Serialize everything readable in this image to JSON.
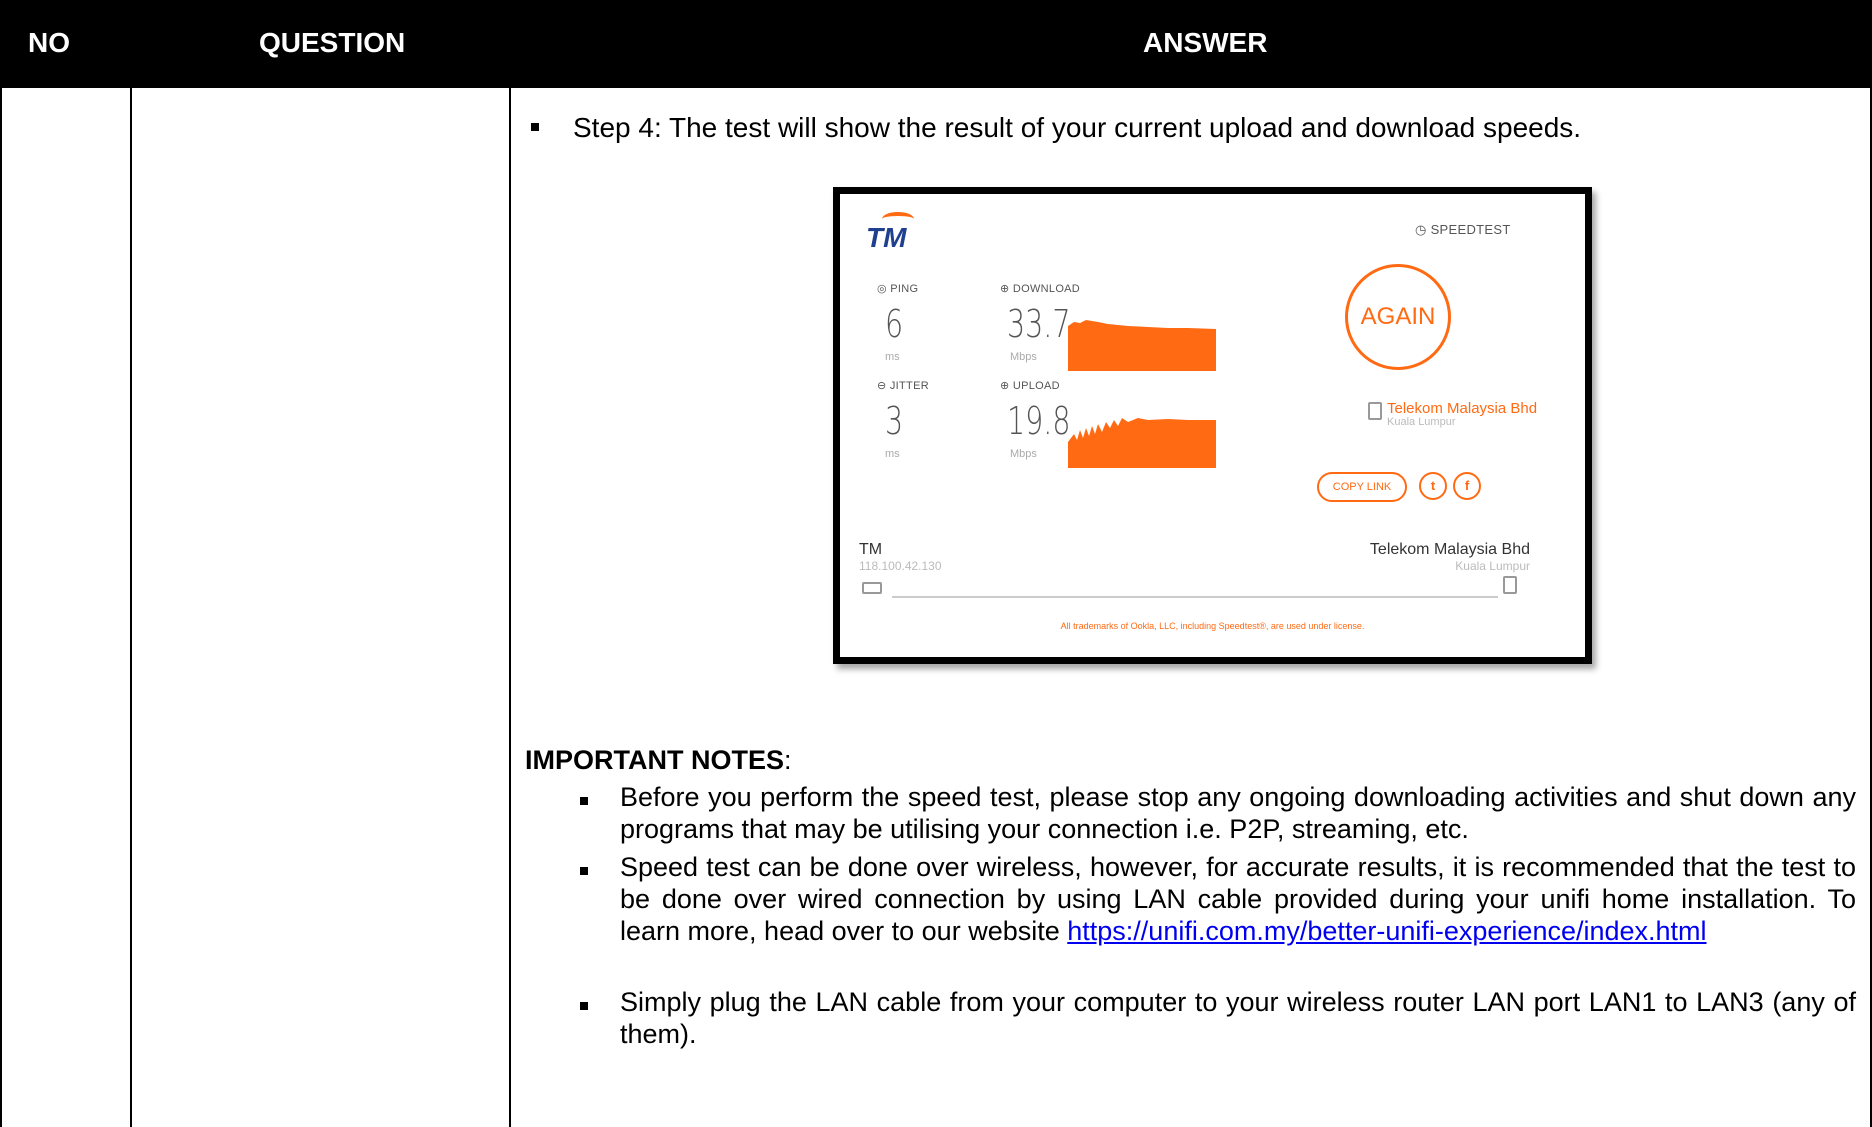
{
  "header": {
    "no": "NO",
    "question": "QUESTION",
    "answer": "ANSWER"
  },
  "step4": "Step 4: The test will show the result of your current upload and download speeds.",
  "speedtest": {
    "brand": "TM",
    "speedtest_label": "SPEEDTEST",
    "ping_label": "PING",
    "ping_value": "6",
    "ping_unit": "ms",
    "download_label": "DOWNLOAD",
    "download_value": "33.7",
    "download_unit": "Mbps",
    "jitter_label": "JITTER",
    "jitter_value": "3",
    "jitter_unit": "ms",
    "upload_label": "UPLOAD",
    "upload_value": "19.8",
    "upload_unit": "Mbps",
    "again_label": "AGAIN",
    "isp_name": "Telekom Malaysia Bhd",
    "isp_city": "Kuala Lumpur",
    "copy_link_label": "COPY LINK",
    "client_name": "TM",
    "client_ip": "118.100.42.130",
    "server_name": "Telekom Malaysia Bhd",
    "server_city": "Kuala Lumpur",
    "license": "All trademarks of Ookla, LLC, including Speedtest®, are used under license.",
    "accent": "#ff6a13"
  },
  "notes": {
    "title": "IMPORTANT NOTES",
    "colon": ":",
    "item1": "Before you perform the speed test, please stop any ongoing downloading activities and shut down any programs that may be utilising your connection i.e. P2P, streaming, etc.",
    "item2": "Speed test can be done over wireless, however, for accurate results, it is recommended that the test to be done over wired connection by using LAN cable provided during your unifi home installation. To learn more, head over to our website",
    "item2_link": "https://unifi.com.my/better-unifi-experience/index.html",
    "item3": "Simply plug the LAN cable from your computer to your wireless router LAN port LAN1 to LAN3 (any of them)."
  }
}
